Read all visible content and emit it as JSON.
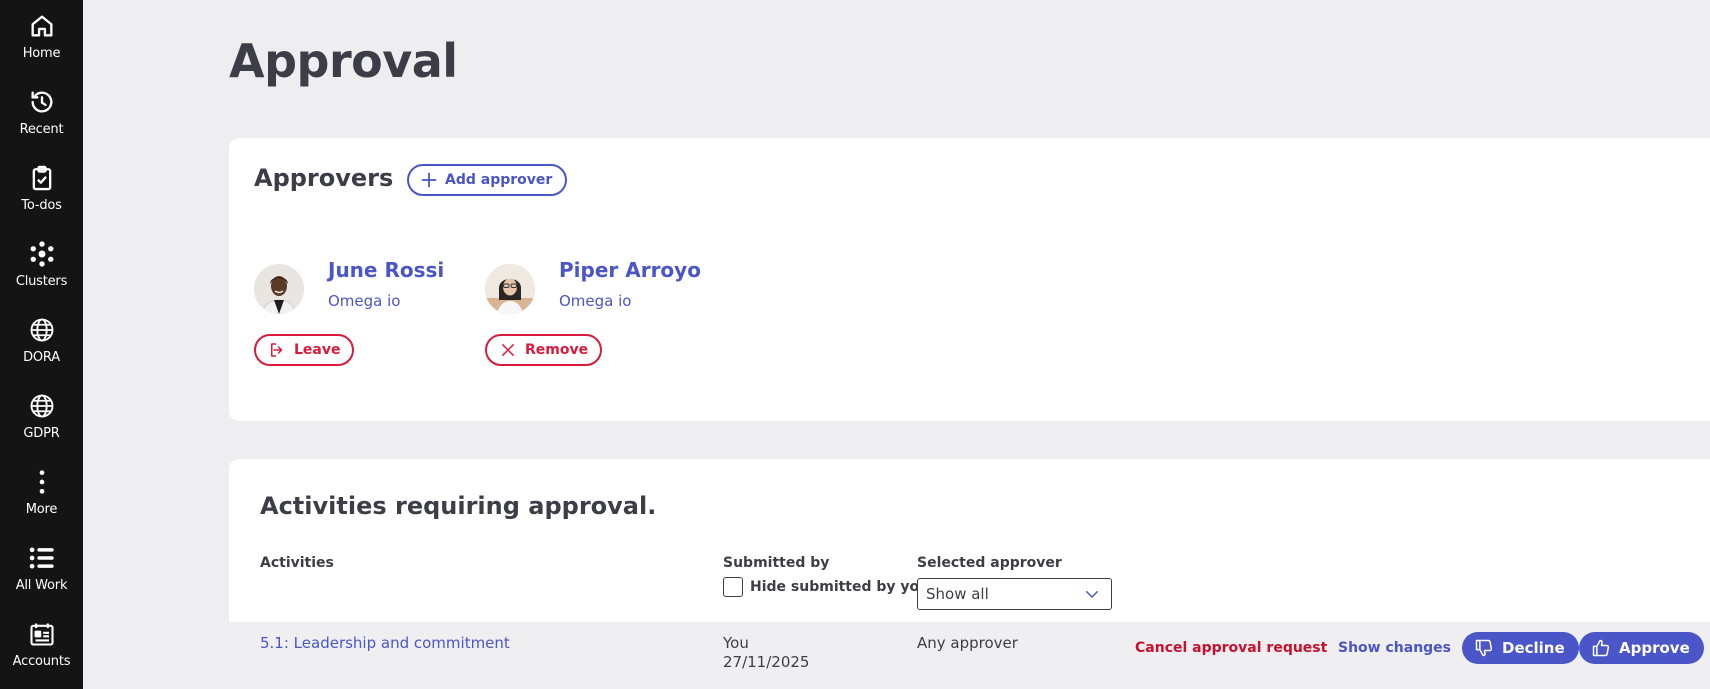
{
  "sidebar": {
    "items": [
      {
        "label": "Home",
        "icon": "home-icon"
      },
      {
        "label": "Recent",
        "icon": "history-icon"
      },
      {
        "label": "To-dos",
        "icon": "clipboard-check-icon"
      },
      {
        "label": "Clusters",
        "icon": "clusters-icon"
      },
      {
        "label": "DORA",
        "icon": "globe-icon"
      },
      {
        "label": "GDPR",
        "icon": "globe-icon"
      },
      {
        "label": "More",
        "icon": "more-vertical-icon"
      },
      {
        "label": "All Work",
        "icon": "list-icon"
      },
      {
        "label": "Accounts",
        "icon": "accounts-icon"
      }
    ]
  },
  "page": {
    "title": "Approval"
  },
  "approvers": {
    "title": "Approvers",
    "add_label": "Add approver",
    "people": [
      {
        "name": "June Rossi",
        "org": "Omega io",
        "action_label": "Leave"
      },
      {
        "name": "Piper Arroyo",
        "org": "Omega io",
        "action_label": "Remove"
      }
    ]
  },
  "activities": {
    "title": "Activities requiring approval.",
    "columns": {
      "activities": "Activities",
      "submitted_by": "Submitted by",
      "selected_approver": "Selected approver"
    },
    "hide_submitted_label": "Hide submitted by you",
    "approver_filter": {
      "selected": "Show all"
    },
    "rows": [
      {
        "activity": "5.1: Leadership and commitment",
        "submitted_by": "You",
        "submitted_date": "27/11/2025",
        "approver": "Any approver",
        "cancel_label": "Cancel approval request",
        "changes_label": "Show changes",
        "decline_label": "Decline",
        "approve_label": "Approve"
      }
    ]
  },
  "colors": {
    "sidebar_bg": "#141414",
    "page_bg": "#eeeef0",
    "accent": "#4a55c8",
    "danger": "#d91a3c",
    "text": "#3d3d47"
  }
}
